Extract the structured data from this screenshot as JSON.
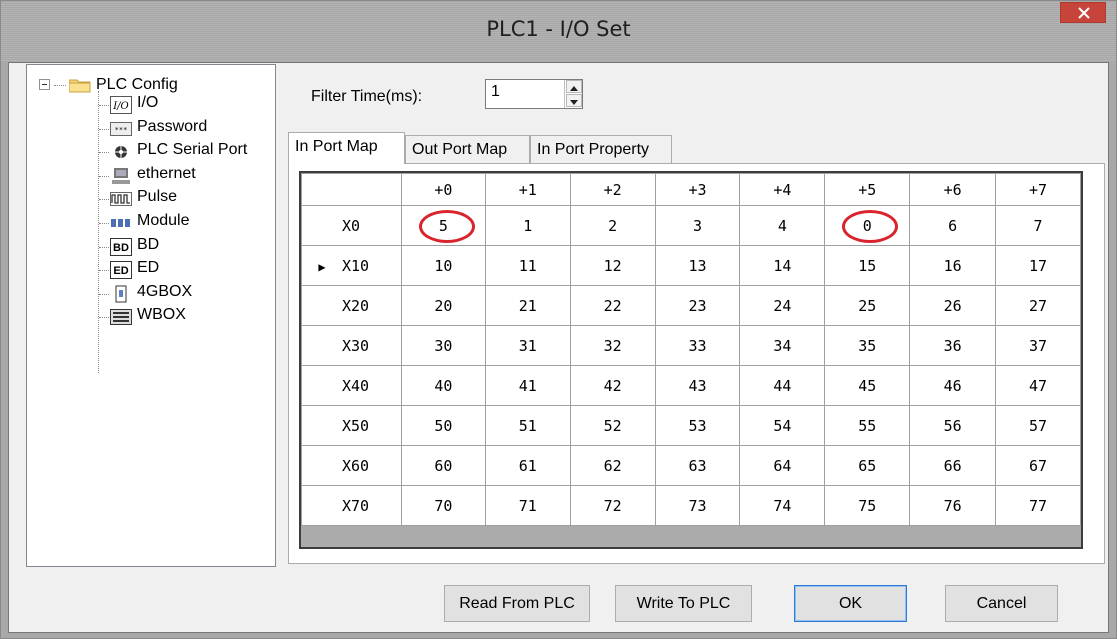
{
  "window": {
    "title": "PLC1 - I/O  Set"
  },
  "tree": {
    "root": "PLC Config",
    "items": [
      {
        "label": "I/O",
        "icon": "io-icon"
      },
      {
        "label": "Password",
        "icon": "password-icon"
      },
      {
        "label": "PLC Serial Port",
        "icon": "serial-port-icon"
      },
      {
        "label": "ethernet",
        "icon": "ethernet-icon"
      },
      {
        "label": "Pulse",
        "icon": "pulse-icon"
      },
      {
        "label": "Module",
        "icon": "module-icon"
      },
      {
        "label": "BD",
        "icon": "bd-icon"
      },
      {
        "label": "ED",
        "icon": "ed-icon"
      },
      {
        "label": "4GBOX",
        "icon": "4gbox-icon"
      },
      {
        "label": "WBOX",
        "icon": "wbox-icon"
      }
    ]
  },
  "filter": {
    "label": "Filter Time(ms):",
    "value": "1"
  },
  "tabs": [
    "In Port Map",
    "Out Port Map",
    "In Port Property"
  ],
  "table": {
    "columns": [
      "+0",
      "+1",
      "+2",
      "+3",
      "+4",
      "+5",
      "+6",
      "+7"
    ],
    "rows": [
      {
        "label": "X0",
        "cells": [
          "5",
          "1",
          "2",
          "3",
          "4",
          "0",
          "6",
          "7"
        ]
      },
      {
        "label": "X10",
        "cells": [
          "10",
          "11",
          "12",
          "13",
          "14",
          "15",
          "16",
          "17"
        ]
      },
      {
        "label": "X20",
        "cells": [
          "20",
          "21",
          "22",
          "23",
          "24",
          "25",
          "26",
          "27"
        ]
      },
      {
        "label": "X30",
        "cells": [
          "30",
          "31",
          "32",
          "33",
          "34",
          "35",
          "36",
          "37"
        ]
      },
      {
        "label": "X40",
        "cells": [
          "40",
          "41",
          "42",
          "43",
          "44",
          "45",
          "46",
          "47"
        ]
      },
      {
        "label": "X50",
        "cells": [
          "50",
          "51",
          "52",
          "53",
          "54",
          "55",
          "56",
          "57"
        ]
      },
      {
        "label": "X60",
        "cells": [
          "60",
          "61",
          "62",
          "63",
          "64",
          "65",
          "66",
          "67"
        ]
      },
      {
        "label": "X70",
        "cells": [
          "70",
          "71",
          "72",
          "73",
          "74",
          "75",
          "76",
          "77"
        ]
      }
    ],
    "current_row_indicator": "▶"
  },
  "buttons": {
    "read": "Read From PLC",
    "write": "Write To PLC",
    "ok": "OK",
    "cancel": "Cancel"
  },
  "colors": {
    "highlight_ring": "#d9232d",
    "close_button": "#c7443a"
  }
}
